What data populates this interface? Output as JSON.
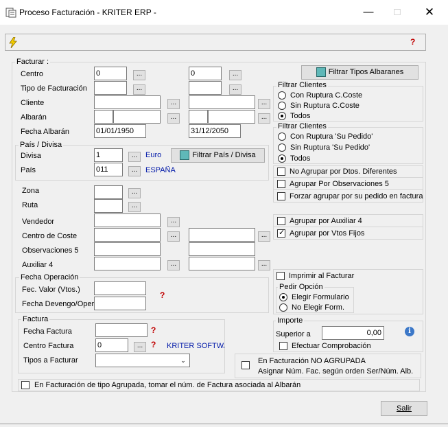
{
  "window": {
    "title": "Proceso Facturación - KRITER ERP -"
  },
  "icons": {
    "app": "invoice-window-icon",
    "lightning": "lightning-icon",
    "help": "help-question-icon",
    "info": "info-icon",
    "dropdown": "chevron-down-icon"
  },
  "facturar": {
    "group_label": "Facturar :",
    "centro_label": "Centro",
    "centro_from": "0",
    "centro_to": "0",
    "tipo_label": "Tipo de Facturación",
    "cliente_label": "Cliente",
    "albaran_label": "Albarán",
    "fecha_albaran_label": "Fecha Albarán",
    "fecha_from": "01/01/1950",
    "fecha_to": "31/12/2050",
    "filtrar_tipos_label": "Filtrar Tipos Albaranes",
    "ellipsis": "..."
  },
  "pais_divisa": {
    "group_label": "País / Divisa",
    "divisa_label": "Divisa",
    "divisa_value": "1",
    "divisa_name": "Euro",
    "filtrar_label": "Filtrar País / Divisa",
    "pais_label": "País",
    "pais_value": "011",
    "pais_name": "ESPAÑA"
  },
  "filtrar_clientes_1": {
    "label": "Filtrar Clientes",
    "options": [
      "Con Ruptura C.Coste",
      "Sin Ruptura C.Coste",
      "Todos"
    ],
    "selected": "Todos"
  },
  "filtrar_clientes_2": {
    "label": "Filtrar Clientes",
    "options": [
      "Con Ruptura 'Su Pedido'",
      "Sin Ruptura 'Su Pedido'",
      "Todos"
    ],
    "selected": "Todos"
  },
  "agrupar_options": [
    {
      "label": "No Agrupar por Dtos. Diferentes",
      "checked": false
    },
    {
      "label": "Agrupar Por Observaciones 5",
      "checked": false
    },
    {
      "label": "Forzar agrupar por su pedido en factura",
      "checked": false
    }
  ],
  "auxiliar_options": [
    {
      "label": "Agrupar por Auxiliar 4",
      "checked": false
    },
    {
      "label": "Agrupar por Vtos Fijos",
      "checked": true
    }
  ],
  "otros": {
    "zona_label": "Zona",
    "ruta_label": "Ruta",
    "vendedor_label": "Vendedor",
    "centro_coste_label": "Centro de Coste",
    "observaciones_label": "Observaciones 5",
    "auxiliar_label": "Auxiliar 4"
  },
  "fecha_operacion": {
    "group_label": "Fecha Operación",
    "fec_valor_label": "Fec. Valor (Vtos.)",
    "fecha_devengo_label": "Fecha Devengo/Oper"
  },
  "imprimir": {
    "label": "Imprimir al Facturar",
    "checked": false,
    "pedir_label": "Pedir Opción",
    "options": [
      "Elegir Formulario",
      "No Elegir Form."
    ],
    "selected": "Elegir Formulario"
  },
  "factura": {
    "group_label": "Factura",
    "fecha_label": "Fecha Factura",
    "centro_label": "Centro Factura",
    "centro_value": "0",
    "centro_name": "KRITER SOFTWARE",
    "tipos_label": "Tipos a Facturar"
  },
  "importe": {
    "group_label": "Importe",
    "superior_label": "Superior a",
    "superior_value": "0,00",
    "comprobacion_label": "Efectuar Comprobación",
    "comprobacion_checked": false
  },
  "no_agrupada": {
    "line1": "En Facturación NO AGRUPADA",
    "line2": "Asignar Núm. Fac. según orden Ser/Núm. Alb.",
    "checked": false
  },
  "bottom_option": {
    "label": "En Facturación de tipo Agrupada, tomar el núm. de Factura asociada al Albarán",
    "checked": false
  },
  "salir_label": "Salir"
}
